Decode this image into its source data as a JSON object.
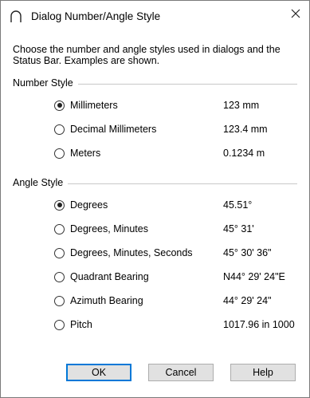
{
  "window": {
    "title": "Dialog Number/Angle Style",
    "close_glyph": "✕",
    "app_icon": "arc-icon"
  },
  "intro_text": "Choose the number and angle styles used in dialogs and the Status Bar.  Examples are shown.",
  "number_style": {
    "label": "Number Style",
    "options": [
      {
        "label": "Millimeters",
        "example": "123 mm",
        "checked": true
      },
      {
        "label": "Decimal Millimeters",
        "example": "123.4 mm",
        "checked": false
      },
      {
        "label": "Meters",
        "example": "0.1234 m",
        "checked": false
      }
    ]
  },
  "angle_style": {
    "label": "Angle Style",
    "options": [
      {
        "label": "Degrees",
        "example": "45.51°",
        "checked": true
      },
      {
        "label": "Degrees, Minutes",
        "example": "45° 31'",
        "checked": false
      },
      {
        "label": "Degrees, Minutes, Seconds",
        "example": "45° 30' 36\"",
        "checked": false
      },
      {
        "label": "Quadrant Bearing",
        "example": "N44° 29' 24\"E",
        "checked": false
      },
      {
        "label": "Azimuth Bearing",
        "example": "44° 29' 24\"",
        "checked": false
      },
      {
        "label": "Pitch",
        "example": "1017.96 in 1000",
        "checked": false
      }
    ]
  },
  "buttons": {
    "ok": "OK",
    "cancel": "Cancel",
    "help": "Help"
  }
}
